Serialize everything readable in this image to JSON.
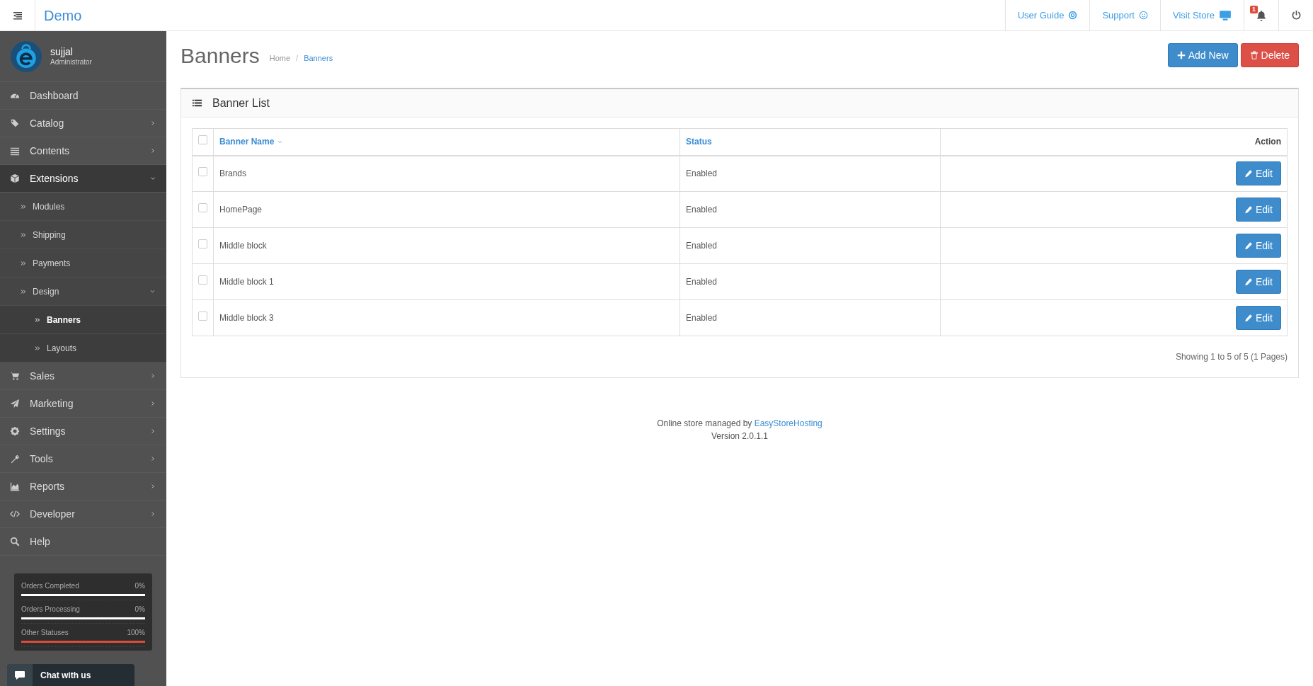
{
  "topbar": {
    "brand": "Demo",
    "links": [
      {
        "label": "User Guide"
      },
      {
        "label": "Support"
      },
      {
        "label": "Visit Store"
      }
    ],
    "notification_count": "1"
  },
  "profile": {
    "name": "sujjal",
    "role": "Administrator"
  },
  "sidebar": {
    "items": [
      {
        "label": "Dashboard",
        "expanded": false
      },
      {
        "label": "Catalog",
        "expanded": false,
        "has_children": true
      },
      {
        "label": "Contents",
        "expanded": false,
        "has_children": true
      },
      {
        "label": "Extensions",
        "expanded": true,
        "has_children": true,
        "children": [
          {
            "label": "Modules",
            "selected": false
          },
          {
            "label": "Shipping",
            "selected": false
          },
          {
            "label": "Payments",
            "selected": false
          },
          {
            "label": "Design",
            "selected": false,
            "expanded": true,
            "children": [
              {
                "label": "Banners",
                "selected": true
              },
              {
                "label": "Layouts",
                "selected": false
              }
            ]
          }
        ]
      },
      {
        "label": "Sales",
        "expanded": false,
        "has_children": true
      },
      {
        "label": "Marketing",
        "expanded": false,
        "has_children": true
      },
      {
        "label": "Settings",
        "expanded": false,
        "has_children": true
      },
      {
        "label": "Tools",
        "expanded": false,
        "has_children": true
      },
      {
        "label": "Reports",
        "expanded": false,
        "has_children": true
      },
      {
        "label": "Developer",
        "expanded": false,
        "has_children": true
      },
      {
        "label": "Help",
        "expanded": false
      }
    ]
  },
  "stats": [
    {
      "label": "Orders Completed",
      "value": "0%",
      "level": 0,
      "color": "#ffffff"
    },
    {
      "label": "Orders Processing",
      "value": "0%",
      "level": 0,
      "color": "#ffffff"
    },
    {
      "label": "Other Statuses",
      "value": "100%",
      "level": 1,
      "color": "#dd4b39"
    }
  ],
  "chat": {
    "label": "Chat with us"
  },
  "page": {
    "title": "Banners",
    "breadcrumb_separator": "/",
    "breadcrumb": [
      {
        "label": "Home",
        "selected": false
      },
      {
        "label": "Banners",
        "selected": true
      }
    ],
    "buttons": [
      {
        "label": "Add New",
        "kind": "add"
      },
      {
        "label": "Delete",
        "kind": "delete"
      }
    ]
  },
  "panel": {
    "title": "Banner List"
  },
  "table": {
    "select_all": {
      "checked": false
    },
    "columns": [
      {
        "label": "Banner Name",
        "link": true,
        "sorted": true
      },
      {
        "label": "Status",
        "link": true,
        "sorted": false
      },
      {
        "label": "Action",
        "link": false,
        "sorted": false
      }
    ],
    "rows": [
      {
        "checked": false,
        "name": "Brands",
        "status": "Enabled",
        "action": "Edit"
      },
      {
        "checked": false,
        "name": "HomePage",
        "status": "Enabled",
        "action": "Edit"
      },
      {
        "checked": false,
        "name": "Middle block",
        "status": "Enabled",
        "action": "Edit"
      },
      {
        "checked": false,
        "name": "Middle block 1",
        "status": "Enabled",
        "action": "Edit"
      },
      {
        "checked": false,
        "name": "Middle block 3",
        "status": "Enabled",
        "action": "Edit"
      }
    ]
  },
  "pagination": {
    "summary": "Showing 1 to 5 of 5 (1 Pages)"
  },
  "footer": {
    "text": "Online store managed by",
    "link": "EasyStoreHosting",
    "version": "Version 2.0.1.1"
  }
}
